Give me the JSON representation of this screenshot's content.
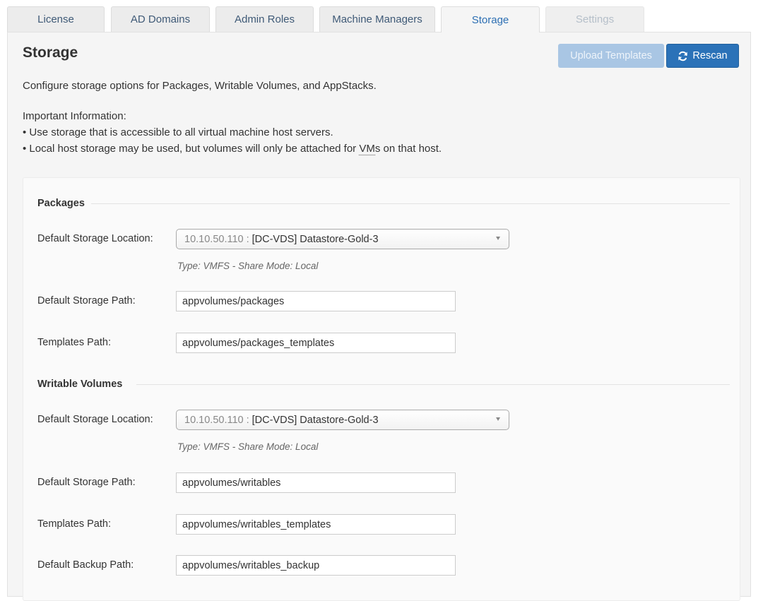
{
  "tabs": [
    {
      "label": "License",
      "state": "normal"
    },
    {
      "label": "AD Domains",
      "state": "normal"
    },
    {
      "label": "Admin Roles",
      "state": "normal"
    },
    {
      "label": "Machine Managers",
      "state": "normal"
    },
    {
      "label": "Storage",
      "state": "active"
    },
    {
      "label": "Settings",
      "state": "disabled"
    }
  ],
  "page": {
    "title": "Storage",
    "upload_button": "Upload Templates",
    "rescan_button": "Rescan",
    "rescan_icon": "refresh-icon",
    "description": "Configure storage options for Packages, Writable Volumes, and AppStacks.",
    "info_heading": "Important Information:",
    "info_line1": "• Use storage that is accessible to all virtual machine host servers.",
    "info_line2_pre": "• Local host storage may be used, but volumes will only be attached for ",
    "info_line2_abbr": "VM",
    "info_line2_post": "s on that host."
  },
  "packages": {
    "heading": "Packages",
    "location_label": "Default Storage Location:",
    "location_ip": "10.10.50.110",
    "location_sep": ":",
    "location_store": "[DC-VDS] Datastore-Gold-3",
    "location_hint": "Type: VMFS - Share Mode: Local",
    "path_label": "Default Storage Path:",
    "path_value": "appvolumes/packages",
    "templates_label": "Templates Path:",
    "templates_value": "appvolumes/packages_templates"
  },
  "writable": {
    "heading": "Writable Volumes",
    "location_label": "Default Storage Location:",
    "location_ip": "10.10.50.110",
    "location_sep": ":",
    "location_store": "[DC-VDS] Datastore-Gold-3",
    "location_hint": "Type: VMFS - Share Mode: Local",
    "path_label": "Default Storage Path:",
    "path_value": "appvolumes/writables",
    "templates_label": "Templates Path:",
    "templates_value": "appvolumes/writables_templates",
    "backup_label": "Default Backup Path:",
    "backup_value": "appvolumes/writables_backup"
  },
  "colors": {
    "accent": "#2b72b8",
    "accent_disabled": "#a9c6e4",
    "tab_active_text": "#2d6fb3"
  }
}
